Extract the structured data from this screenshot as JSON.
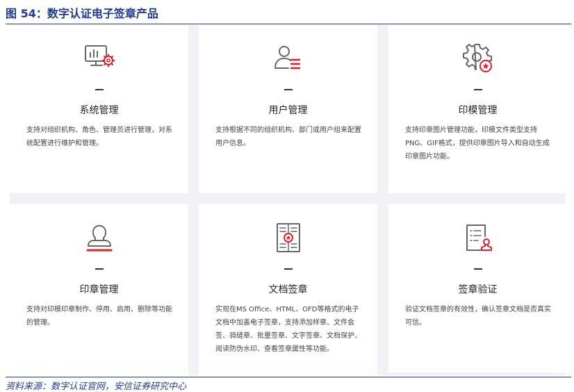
{
  "figure_title": "图 54：数字认证电子签章产品",
  "source": "资料来源：数字认证官网，安信证券研究中心",
  "colors": {
    "accent": "#e0202a",
    "navy": "#1f3a93",
    "icon_gray": "#666666"
  },
  "cards": [
    {
      "icon": "monitor-gear-icon",
      "title": "系统管理",
      "desc": "支持对组织机构、角色、管理员进行管理，对系统配置进行维护和管理。"
    },
    {
      "icon": "user-list-icon",
      "title": "用户管理",
      "desc": "支持根据不同的组织机构、部门或用户组来配置用户信息。"
    },
    {
      "icon": "gear-stamp-icon",
      "title": "印模管理",
      "desc": "支持印章图片管理功能，印模文件类型支持PNG、GIF格式，提供印章图片导入和自动生成印章图片功能。"
    },
    {
      "icon": "seal-stamp-icon",
      "title": "印章管理",
      "desc": "支持对印模印章制作、停用、启用、删除等功能的管理。"
    },
    {
      "icon": "document-seal-icon",
      "title": "文档签章",
      "desc": "实现在MS Office、HTML、OFD等格式的电子文档中加盖电子签章，支持添加样章、文件会签、骑缝章、批量签章、文字签章、文档保护、阅读防伪水印、查看签章属性等功能。"
    },
    {
      "icon": "clipboard-verify-icon",
      "title": "签章验证",
      "desc": "验证文档签章的有效性，确认签章文档是否真实可信。"
    }
  ]
}
